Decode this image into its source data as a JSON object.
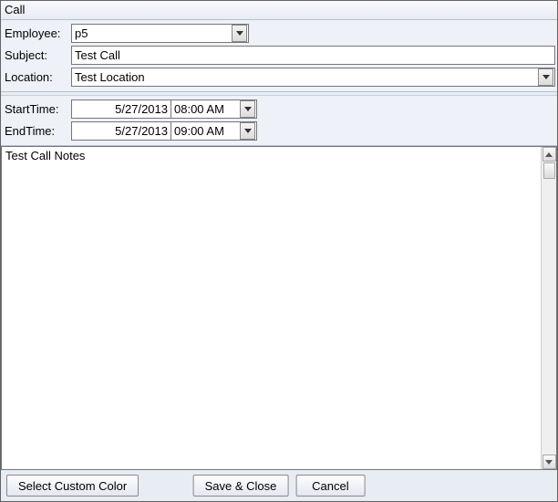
{
  "title": "Call",
  "labels": {
    "employee": "Employee:",
    "subject": "Subject:",
    "location": "Location:",
    "startTime": "StartTime:",
    "endTime": "EndTime:"
  },
  "fields": {
    "employee": "p5",
    "subject": "Test Call",
    "location": "Test Location",
    "startDate": "5/27/2013",
    "startTime": "08:00 AM",
    "endDate": "5/27/2013",
    "endTime": "09:00 AM",
    "notes": "Test Call Notes"
  },
  "buttons": {
    "selectColor": "Select Custom Color",
    "saveClose": "Save & Close",
    "cancel": "Cancel"
  }
}
